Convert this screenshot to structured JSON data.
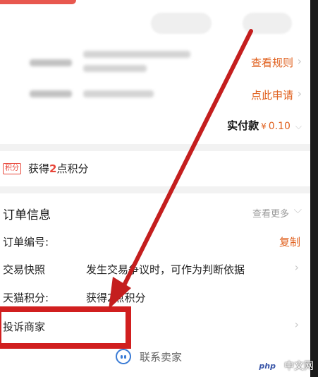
{
  "top_card": {
    "link_view_rules": "查看规则",
    "link_apply": "点此申请",
    "pay_label": "实付款",
    "pay_currency": "¥",
    "pay_amount": "0.10"
  },
  "points_card": {
    "badge": "积分",
    "text_prefix": "获得",
    "points": "2",
    "text_suffix": "点积分"
  },
  "order_info": {
    "title": "订单信息",
    "see_more": "查看更多",
    "rows": [
      {
        "label": "订单编号:",
        "value": "",
        "action": "复制"
      },
      {
        "label": "交易快照",
        "value": "发生交易争议时，可作为判断依据"
      },
      {
        "label": "天猫积分:",
        "value": "获得2点积分"
      },
      {
        "label": "投诉商家"
      }
    ],
    "contact_seller": "联系卖家"
  },
  "watermark": {
    "logo": "php",
    "site": "中文网"
  },
  "colors": {
    "accent_orange": "#e0611f",
    "points_red": "#e8463a",
    "annotation_red": "#d11f1f",
    "contact_blue": "#3a7bd5"
  }
}
